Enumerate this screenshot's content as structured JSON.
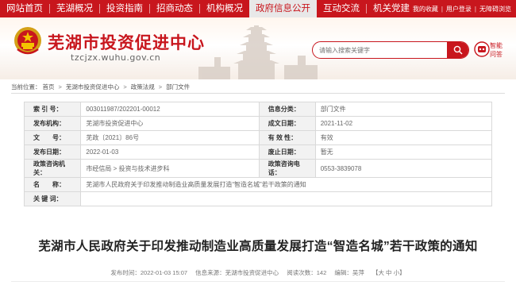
{
  "nav": {
    "items": [
      "网站首页",
      "芜湖概况",
      "投资指南",
      "招商动态",
      "机构概况",
      "政府信息公开",
      "互动交流",
      "机关党建"
    ],
    "active_index": 5,
    "utils": [
      "我的收藏",
      "用户登录",
      "无障碍浏览"
    ]
  },
  "header": {
    "site_title": "芜湖市投资促进中心",
    "site_url": "tzcjzx.wuhu.gov.cn",
    "search_placeholder": "请输入搜索关键字",
    "zhuli_label": "智能问答"
  },
  "breadcrumb": {
    "prefix": "当前位置：",
    "items": [
      "首页",
      "芜湖市投资促进中心",
      "政策法规",
      "部门文件"
    ]
  },
  "info_table": {
    "index_label": "索 引 号：",
    "index_value": "003011987/202201-00012",
    "info_cat_label": "信息分类：",
    "info_cat_value": "部门文件",
    "issuer_label": "发布机构：",
    "issuer_value": "芜湖市投资促进中心",
    "created_label": "成文日期：",
    "created_value": "2021-11-02",
    "docno_label": "文　　号：",
    "docno_value": "芜政〔2021〕86号",
    "validity_label": "有 效 性：",
    "validity_value": "有效",
    "pubdate_label": "发布日期：",
    "pubdate_value": "2022-01-03",
    "abolish_label": "废止日期：",
    "abolish_value": "暂无",
    "policy_label": "政策咨询机关：",
    "policy_value": "市经信局 > 投资与技术进步科",
    "phone_label": "政策咨询电话：",
    "phone_value": "0553-3839078",
    "name_label": "名　　称：",
    "name_value": "芜湖市人民政府关于印发推动制造业高质量发展打造“智造名城”若干政策的通知",
    "keyword_label": "关 键 词：",
    "keyword_value": ""
  },
  "article": {
    "title": "芜湖市人民政府关于印发推动制造业高质量发展打造“智造名城”若干政策的通知",
    "published": "发布时间：2022-01-03 15:07",
    "source": "信息来源：芜湖市投资促进中心",
    "views": "阅读次数：142",
    "editor": "编辑：吴萍",
    "font_size": "【大 中 小】"
  },
  "colors": {
    "brand_red": "#c8161d",
    "label_bg": "#f2f2f2",
    "border": "#d9d9d9"
  }
}
